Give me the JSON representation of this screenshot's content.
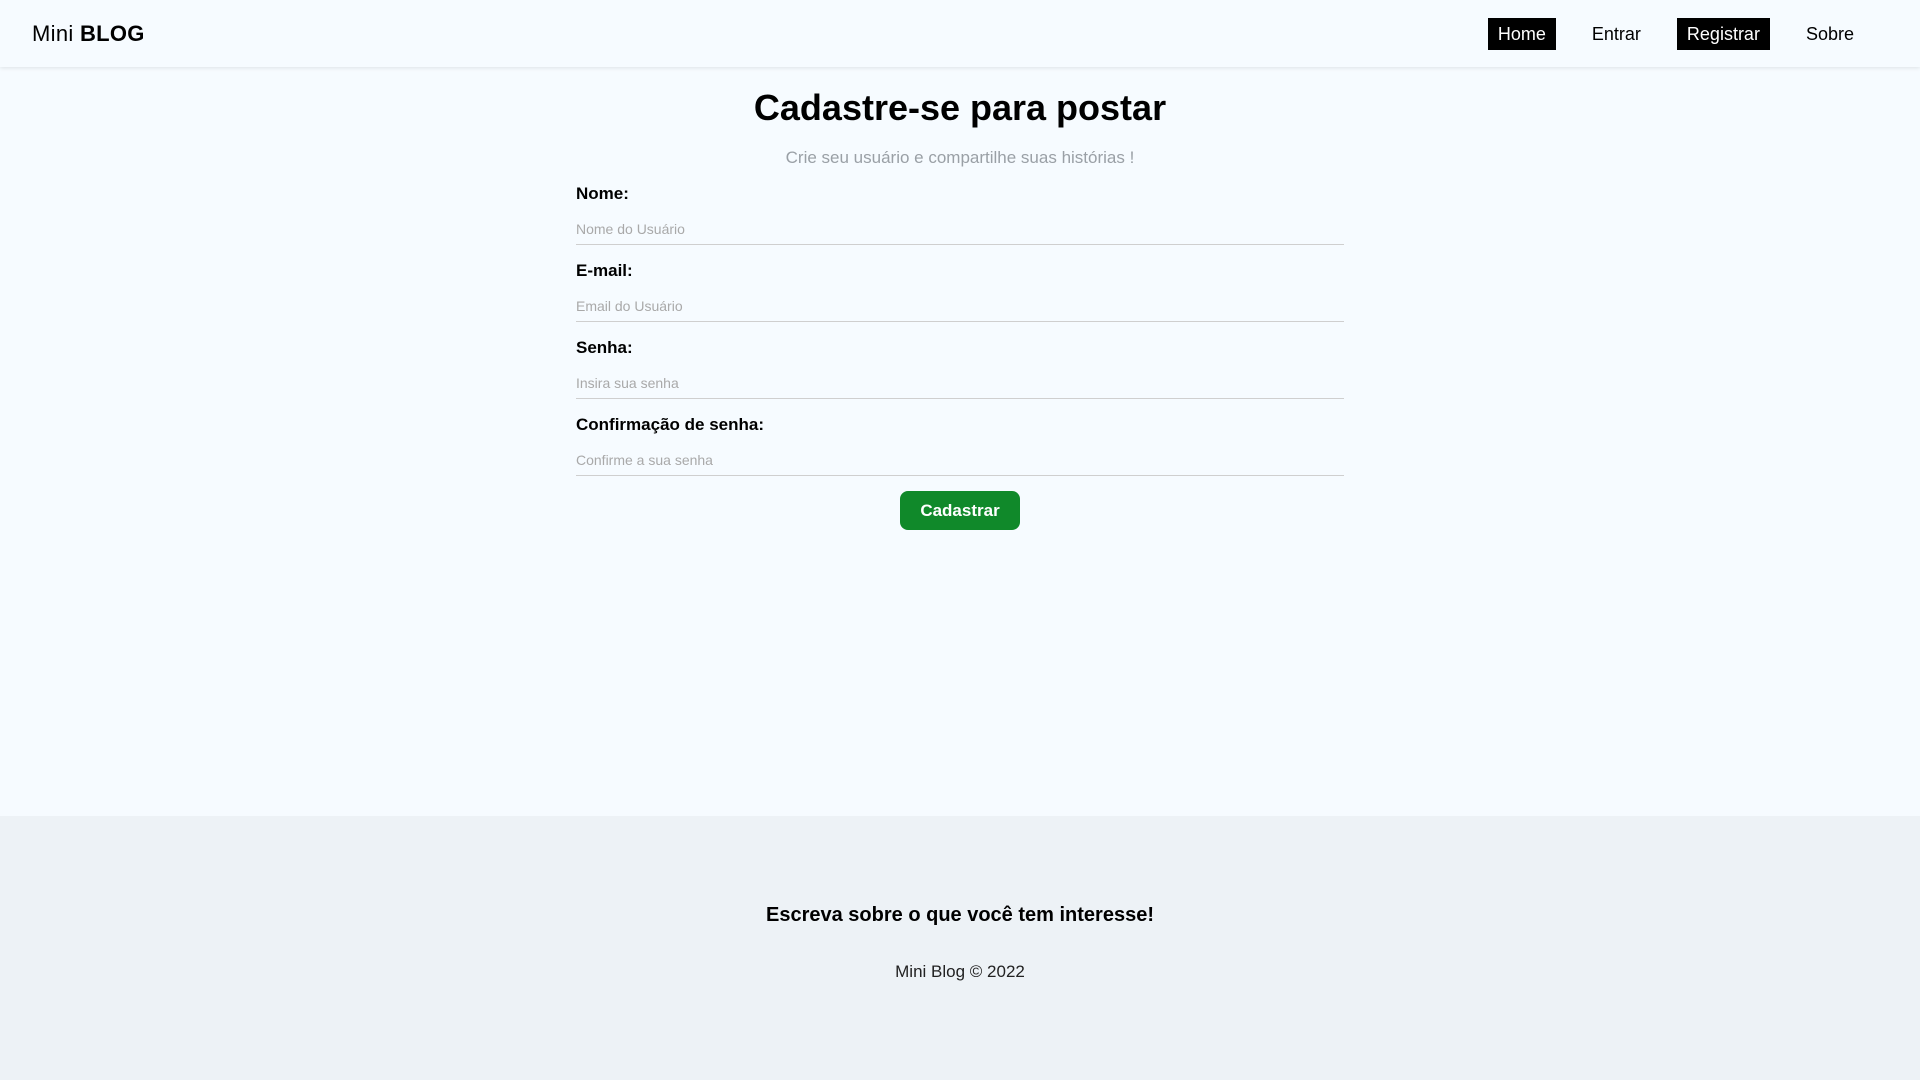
{
  "navbar": {
    "brand_light": "Mini",
    "brand_bold": "BLOG",
    "links": [
      {
        "label": "Home",
        "active": true
      },
      {
        "label": "Entrar",
        "active": false
      },
      {
        "label": "Registrar",
        "active": true
      },
      {
        "label": "Sobre",
        "active": false
      }
    ]
  },
  "main": {
    "title": "Cadastre-se para postar",
    "subtitle": "Crie seu usuário e compartilhe suas histórias !",
    "fields": [
      {
        "label": "Nome:",
        "placeholder": "Nome do Usuário",
        "value": ""
      },
      {
        "label": "E-mail:",
        "placeholder": "Email do Usuário",
        "value": ""
      },
      {
        "label": "Senha:",
        "placeholder": "Insira sua senha",
        "value": ""
      },
      {
        "label": "Confirmação de senha:",
        "placeholder": "Confirme a sua senha",
        "value": ""
      }
    ],
    "submit_label": "Cadastrar"
  },
  "footer": {
    "headline": "Escreva sobre o que você tem interesse!",
    "copyright": "Mini Blog © 2022"
  },
  "colors": {
    "background": "#f6fbff",
    "footer_background": "#edf2f6",
    "active_nav": "#000000",
    "button": "#10892a"
  }
}
